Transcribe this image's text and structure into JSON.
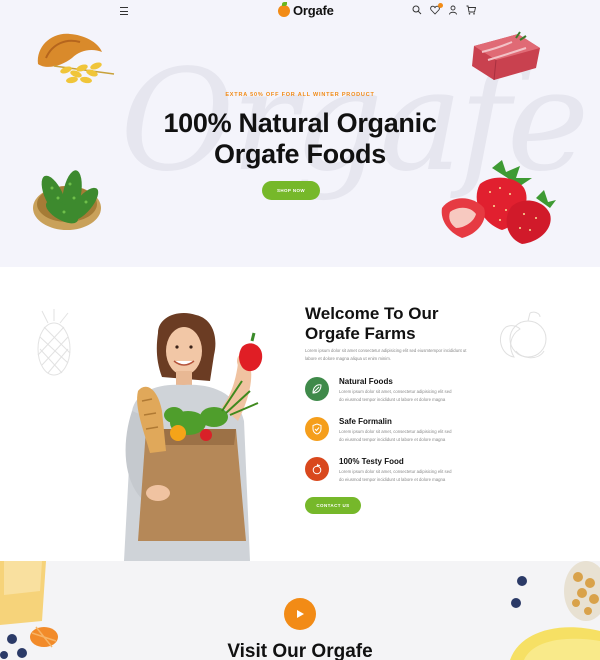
{
  "brand": {
    "name": "Orgafe",
    "orange": "#f28b16",
    "green": "#76b82a"
  },
  "header": {
    "menu_icon": "hamburger-icon",
    "icons": [
      "search-icon",
      "wishlist-icon",
      "user-icon",
      "cart-icon"
    ]
  },
  "hero": {
    "watermark": "Orgafe",
    "promo": "EXTRA 50% OFF FOR ALL WINTER PRODUCT",
    "title_line1": "100% Natural Organic",
    "title_line2": "Orgafe Foods",
    "button_label": "SHOP NOW"
  },
  "about": {
    "title_line1": "Welcome To Our",
    "title_line2": "Orgafe Farms",
    "description": "Lorem ipsum dolor sit amet consectetur adipisicing elit sed eiusmtempor incididunt ut labore et dolore magna aliqua ut enim minim.",
    "features": [
      {
        "title": "Natural Foods",
        "text": "Lorem ipsum dolor sit amet, consectetur adipisicing elit sed do eiusmod tempor incididunt ut labore et dolore magna",
        "icon": "leaf-icon",
        "color": "#3f8a4a"
      },
      {
        "title": "Safe Formalin",
        "text": "Lorem ipsum dolor sit amet, consectetur adipisicing elit sed do eiusmod tempor incididunt ut labore et dolore magna",
        "icon": "shield-icon",
        "color": "#f59e1b"
      },
      {
        "title": "100% Testy Food",
        "text": "Lorem ipsum dolor sit amet, consectetur adipisicing elit sed do eiusmod tempor incididunt ut labore et dolore magna",
        "icon": "fruit-icon",
        "color": "#d9481d"
      }
    ],
    "button_label": "CONTACT US"
  },
  "visit": {
    "play_icon": "play-icon",
    "title": "Visit Our Orgafe"
  }
}
